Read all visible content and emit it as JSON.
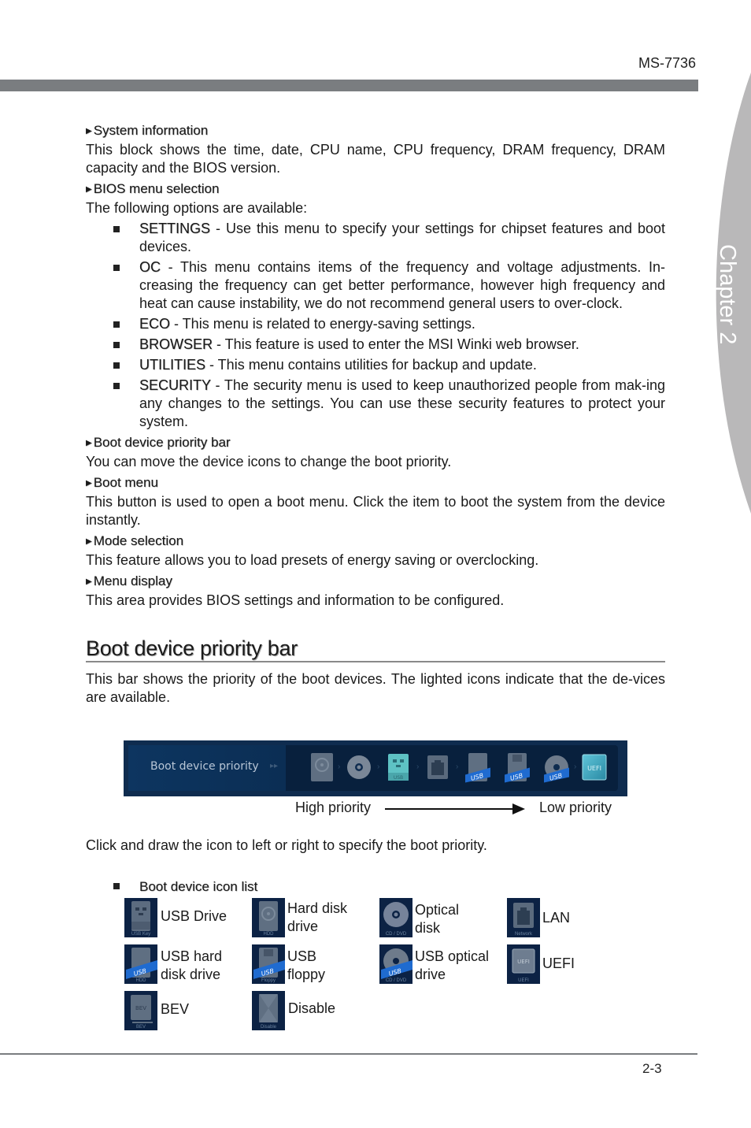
{
  "header": {
    "model": "MS-7736",
    "chapter": "Chapter 2"
  },
  "sections": [
    {
      "title": "System information",
      "body": "This block shows the time, date, CPU name, CPU frequency, DRAM frequency, DRAM capacity and the BIOS version."
    },
    {
      "title": "BIOS menu selection",
      "body": "The following options are available:",
      "options": [
        {
          "key": "SETTINGS",
          "text": " - Use this menu to specify your settings for chipset features and boot devices."
        },
        {
          "key": "OC",
          "text": " - This menu contains items of the frequency and voltage adjustments. In-creasing the frequency can get better performance, however high frequency and heat can cause instability, we do not recommend general users to over-clock."
        },
        {
          "key": "ECO",
          "text": " - This menu is related to energy-saving settings."
        },
        {
          "key": "BROWSER",
          "text": " - This feature is used to enter the MSI Winki web browser."
        },
        {
          "key": "UTILITIES",
          "text": " - This menu contains utilities for backup and update."
        },
        {
          "key": "SECURITY",
          "text": " - The security menu is used to keep unauthorized people from mak-ing any changes to the settings. You can use these security features to protect your system."
        }
      ]
    },
    {
      "title": "Boot device priority bar",
      "body": "You can move the device icons to change the boot priority."
    },
    {
      "title": "Boot menu",
      "body": "This button is used to open a boot menu. Click the item to boot the system from the device instantly."
    },
    {
      "title": "Mode selection",
      "body": "This feature allows you to load presets of energy saving or overclocking."
    },
    {
      "title": "Menu display",
      "body": "This area provides BIOS settings and information to be configured."
    }
  ],
  "boot_bar_section": {
    "heading": "Boot device priority bar",
    "intro": "This bar shows the priority of the boot devices. The lighted icons indicate that the de-vices are available.",
    "bar_label": "Boot device priority",
    "bar_icons": [
      "HDD",
      "CD/DVD",
      "USB Key",
      "Network",
      "USB HDD",
      "USB Floppy",
      "USB CD/DVD",
      "UEFI"
    ],
    "usb_badge": "USB",
    "uefi_text": "UEFI",
    "high_priority": "High priority",
    "low_priority": "Low priority",
    "instruction": "Click and draw the icon to left or right to specify the boot priority."
  },
  "icon_list": {
    "title": "Boot device icon list",
    "items": [
      {
        "label": "USB Drive",
        "caption": "USB Key"
      },
      {
        "label": "Hard disk drive",
        "caption": "HDD"
      },
      {
        "label": "Optical disk",
        "caption": "CD / DVD"
      },
      {
        "label": "LAN",
        "caption": "Network"
      },
      {
        "label": "USB hard disk drive",
        "caption": "HDD"
      },
      {
        "label": "USB floppy",
        "caption": "Floppy"
      },
      {
        "label": "USB optical drive",
        "caption": "CD / DVD"
      },
      {
        "label": "UEFI",
        "caption": "UEFI"
      },
      {
        "label": "BEV",
        "caption": "BEV"
      },
      {
        "label": "Disable",
        "caption": "Disable"
      }
    ]
  },
  "footer": {
    "page": "2-3"
  },
  "colors": {
    "bar_bg": "#0f2c4f",
    "tab_gray": "#b9b8b9",
    "rule_gray": "#7a7d80"
  }
}
